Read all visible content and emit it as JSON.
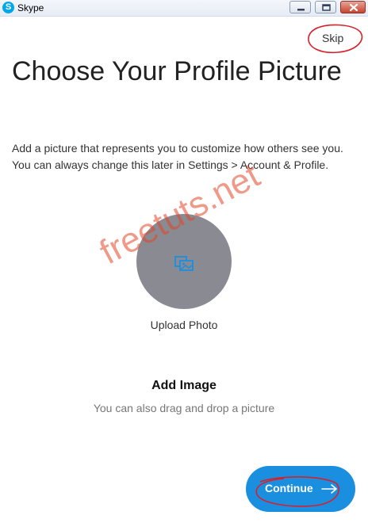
{
  "window": {
    "app_title": "Skype",
    "logo_letter": "S",
    "controls": [
      "minimize-icon",
      "maximize-icon",
      "close-icon"
    ]
  },
  "header": {
    "skip_label": "Skip"
  },
  "main": {
    "title": "Choose Your Profile Picture",
    "description": "Add a picture that represents you to customize how others see you. You can always change this later in Settings > Account & Profile.",
    "upload": {
      "icon": "image-upload-icon",
      "label": "Upload Photo"
    },
    "add_image": {
      "title": "Add Image",
      "hint": "You can also drag and drop a picture"
    }
  },
  "footer": {
    "continue_label": "Continue",
    "continue_icon": "arrow-right-icon"
  },
  "watermark": "freetuts.net",
  "colors": {
    "accent": "#1a8fe0",
    "avatar_placeholder": "#8a8a92",
    "annotation_red": "#d8202a",
    "watermark_red": "#e24628"
  }
}
